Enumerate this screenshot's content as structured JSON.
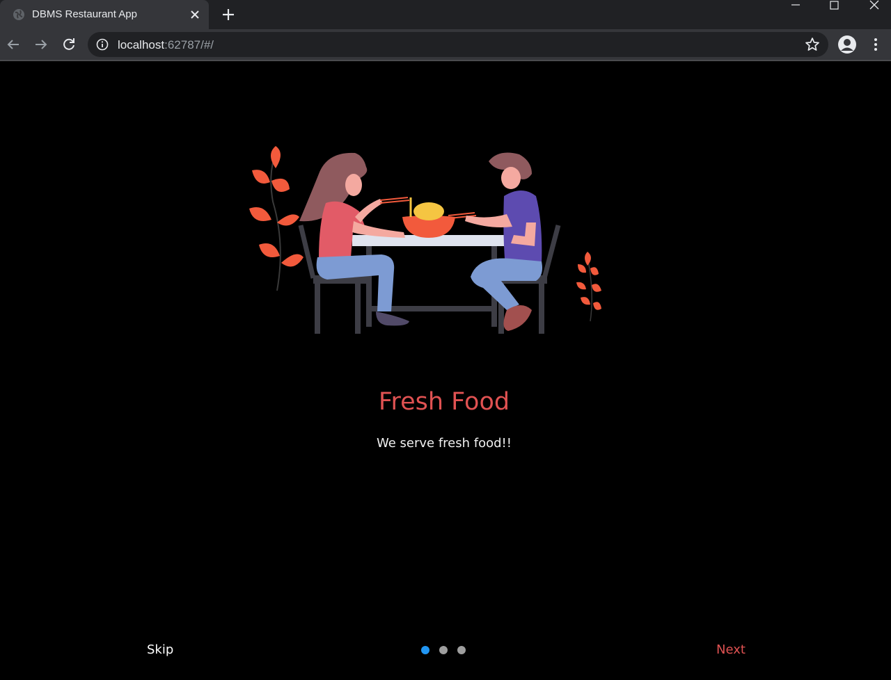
{
  "browser": {
    "tab_title": "DBMS Restaurant App",
    "url_host": "localhost",
    "url_rest": ":62787/#/"
  },
  "onboarding": {
    "title": "Fresh Food",
    "subtitle": "We serve fresh food!!",
    "skip_label": "Skip",
    "next_label": "Next",
    "page_count": 3,
    "active_page": 1
  },
  "colors": {
    "accent": "#e05252",
    "active_dot": "#2196f3",
    "inactive_dot": "#9e9e9e",
    "background": "#000000"
  },
  "icons": {
    "illustration": "couple-dining-illustration"
  }
}
